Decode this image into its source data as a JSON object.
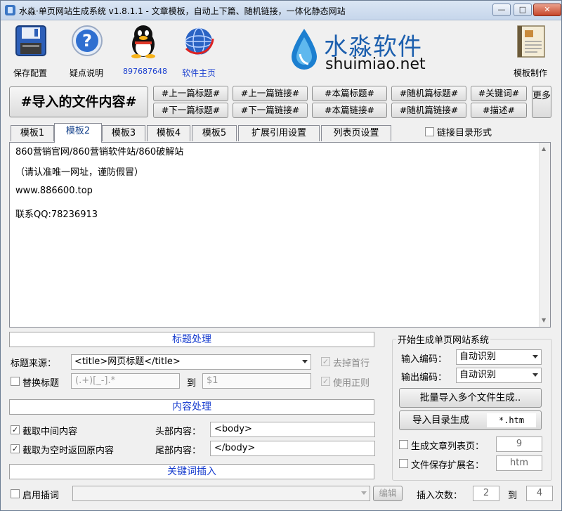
{
  "window": {
    "title": "水淼·单页网站生成系统 v1.8.1.1 - 文章模板，自动上下篇、随机链接，一体化静态网站",
    "minimize": "—",
    "maximize": "□",
    "close": "✕"
  },
  "toolbar": {
    "save": "保存配置",
    "help": "疑点说明",
    "qq": "897687648",
    "homepage": "软件主页",
    "template_make": "模板制作"
  },
  "brand": {
    "name_cn": "水淼软件",
    "domain": "shuimiao.net"
  },
  "insert_buttons": {
    "import_content": "#导入的文件内容#",
    "prev_title": "#上一篇标题#",
    "prev_link": "#上一篇链接#",
    "this_title": "#本篇标题#",
    "random_title": "#随机篇标题#",
    "keyword": "#关键词#",
    "next_title": "#下一篇标题#",
    "next_link": "#下一篇链接#",
    "this_link": "#本篇链接#",
    "random_link": "#随机篇链接#",
    "desc": "#描述#",
    "more": "更多"
  },
  "tabs": [
    "模板1",
    "模板2",
    "模板3",
    "模板4",
    "模板5",
    "扩展引用设置",
    "列表页设置"
  ],
  "link_dir_form": "链接目录形式",
  "editor": {
    "lines": [
      "860营销官网/860营销软件站/860破解站",
      "（请认准唯一网址，谨防假冒）",
      " www.886600.top",
      "联系QQ:78236913"
    ]
  },
  "title_section": {
    "header": "标题处理",
    "source_label": "标题来源：",
    "source_value": "<title>网页标题</title>",
    "remove_first": "去掉首行",
    "replace_title": "替换标题",
    "regex_from": "(.+)[_-].*",
    "to": "到",
    "regex_to": "$1",
    "use_regex": "使用正则"
  },
  "content_section": {
    "header": "内容处理",
    "take_middle": "截取中间内容",
    "head_label": "头部内容：",
    "head_value": "<body>",
    "empty_return": "截取为空时返回原内容",
    "tail_label": "尾部内容：",
    "tail_value": "</body>"
  },
  "keyword_section": {
    "header": "关键词插入",
    "enable": "启用插词",
    "edit": "编辑",
    "insert_count": "插入次数：",
    "from": "2",
    "to": "到",
    "to_value": "4"
  },
  "generate_section": {
    "legend": "开始生成单页网站系统",
    "input_enc_label": "输入编码：",
    "input_enc": "自动识别",
    "output_enc_label": "输出编码：",
    "output_enc": "自动识别",
    "batch_import": "批量导入多个文件生成..",
    "import_dir": "导入目录生成",
    "import_dir_ext": "*.htm",
    "gen_list": "生成文章列表页：",
    "gen_list_value": "9",
    "save_ext": "文件保存扩展名：",
    "save_ext_value": "htm"
  },
  "colors": {
    "header_blue": "#1a3fcf",
    "active_tab": "#15428b",
    "brand_blue": "#1c5fae"
  }
}
